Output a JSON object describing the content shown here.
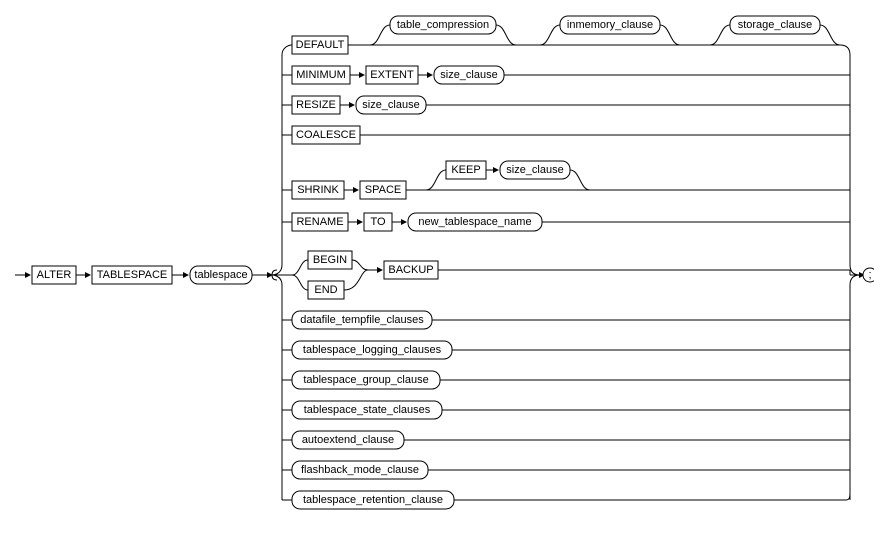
{
  "chart_data": {
    "type": "railroad-diagram",
    "statement": "ALTER TABLESPACE",
    "prefix": [
      "ALTER",
      "TABLESPACE",
      "tablespace (nonterminal)"
    ],
    "branches": [
      {
        "items": [
          "DEFAULT",
          "table_compression?",
          "inmemory_clause?",
          "storage_clause?"
        ]
      },
      {
        "items": [
          "MINIMUM",
          "EXTENT",
          "size_clause"
        ]
      },
      {
        "items": [
          "RESIZE",
          "size_clause"
        ]
      },
      {
        "items": [
          "COALESCE"
        ]
      },
      {
        "items": [
          "SHRINK",
          "SPACE",
          "(KEEP size_clause)?"
        ]
      },
      {
        "items": [
          "RENAME",
          "TO",
          "new_tablespace_name"
        ]
      },
      {
        "items": [
          "(BEGIN | END)",
          "BACKUP"
        ]
      },
      {
        "items": [
          "datafile_tempfile_clauses"
        ]
      },
      {
        "items": [
          "tablespace_logging_clauses"
        ]
      },
      {
        "items": [
          "tablespace_group_clause"
        ]
      },
      {
        "items": [
          "tablespace_state_clauses"
        ]
      },
      {
        "items": [
          "autoextend_clause"
        ]
      },
      {
        "items": [
          "flashback_mode_clause"
        ]
      },
      {
        "items": [
          "tablespace_retention_clause"
        ]
      }
    ],
    "terminator": ";"
  },
  "kw": {
    "alter": "ALTER",
    "tablespace": "TABLESPACE",
    "default": "DEFAULT",
    "minimum": "MINIMUM",
    "extent": "EXTENT",
    "resize": "RESIZE",
    "coalesce": "COALESCE",
    "shrink": "SHRINK",
    "space": "SPACE",
    "keep": "KEEP",
    "rename": "RENAME",
    "to": "TO",
    "begin": "BEGIN",
    "end": "END",
    "backup": "BACKUP"
  },
  "nt": {
    "tablespace": "tablespace",
    "table_compression": "table_compression",
    "inmemory_clause": "inmemory_clause",
    "storage_clause": "storage_clause",
    "size_clause": "size_clause",
    "size_clause2": "size_clause",
    "size_clause3": "size_clause",
    "new_tablespace_name": "new_tablespace_name",
    "datafile_tempfile_clauses": "datafile_tempfile_clauses",
    "tablespace_logging_clauses": "tablespace_logging_clauses",
    "tablespace_group_clause": "tablespace_group_clause",
    "tablespace_state_clauses": "tablespace_state_clauses",
    "autoextend_clause": "autoextend_clause",
    "flashback_mode_clause": "flashback_mode_clause",
    "tablespace_retention_clause": "tablespace_retention_clause",
    "semicolon": ";"
  }
}
